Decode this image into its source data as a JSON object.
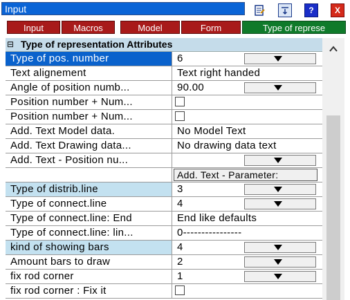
{
  "window": {
    "title": "Input",
    "buttons": [
      "doc-edit-icon",
      "sort-icon",
      "help-icon",
      "close-icon"
    ],
    "help_label": "?",
    "close_label": "X"
  },
  "tabs": [
    {
      "label": "Input",
      "bg": "#a81a1a"
    },
    {
      "label": "Macros",
      "bg": "#a81a1a"
    },
    {
      "label": "Model",
      "bg": "#a81a1a"
    },
    {
      "label": "Form",
      "bg": "#a81a1a"
    },
    {
      "label": "Type of represe",
      "bg": "#0f7a2a"
    }
  ],
  "group": {
    "title": "Type of representation Attributes",
    "collapse_glyph": "⊟"
  },
  "rows": [
    {
      "label": "Type of pos. number",
      "value": "6",
      "dropdown": true,
      "style": "sel"
    },
    {
      "label": "Text alignement",
      "value": "Text right handed"
    },
    {
      "label": "Angle of position numb...",
      "value": "90.00",
      "dropdown": true
    },
    {
      "label": "Position number + Num...",
      "value": "",
      "checkbox": true
    },
    {
      "label": "Position number + Num...",
      "value": "",
      "checkbox": true
    },
    {
      "label": "Add. Text Model data.",
      "value": "No Model Text"
    },
    {
      "label": "Add. Text Drawing data...",
      "value": "No drawing data text"
    },
    {
      "label": "Add. Text - Position nu...",
      "value": "",
      "dropdown": true
    },
    {
      "label": "",
      "value": "",
      "button": "Add. Text - Parameter:"
    },
    {
      "label": "Type of distrib.line",
      "value": "3",
      "dropdown": true,
      "style": "hl"
    },
    {
      "label": "Type of connect.line",
      "value": "4",
      "dropdown": true
    },
    {
      "label": "Type of connect.line: End",
      "value": "End like defaults"
    },
    {
      "label": "Type of connect.line: lin...",
      "value": "0----------------"
    },
    {
      "label": "kind of showing bars",
      "value": "4",
      "dropdown": true,
      "style": "hl"
    },
    {
      "label": "Amount bars to draw",
      "value": "2",
      "dropdown": true
    },
    {
      "label": "fix rod corner",
      "value": "1",
      "dropdown": true
    },
    {
      "label": "fix rod corner      : Fix it",
      "value": "",
      "checkbox": true
    }
  ]
}
